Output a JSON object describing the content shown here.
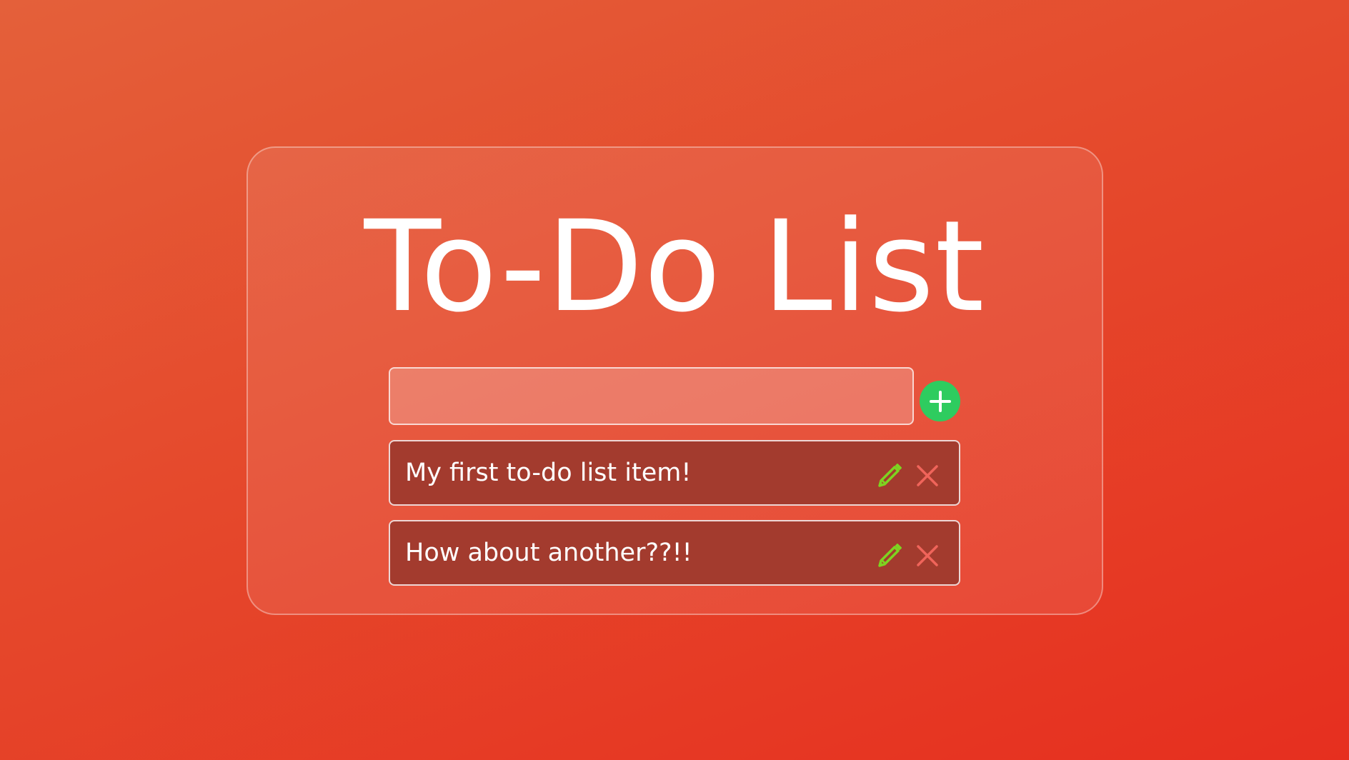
{
  "app": {
    "title": "To-Do List"
  },
  "add_form": {
    "input_value": "",
    "input_placeholder": "",
    "add_icon": "plus-icon"
  },
  "todos": [
    {
      "text": "My first to-do list item!",
      "edit_icon": "pencil-icon",
      "delete_icon": "close-icon"
    },
    {
      "text": "How about another??!!",
      "edit_icon": "pencil-icon",
      "delete_icon": "close-icon"
    }
  ],
  "colors": {
    "accent_add": "#2ecc5f",
    "edit_icon": "#7ed321",
    "delete_icon": "#f0645a",
    "item_background": "#a33b2e"
  }
}
